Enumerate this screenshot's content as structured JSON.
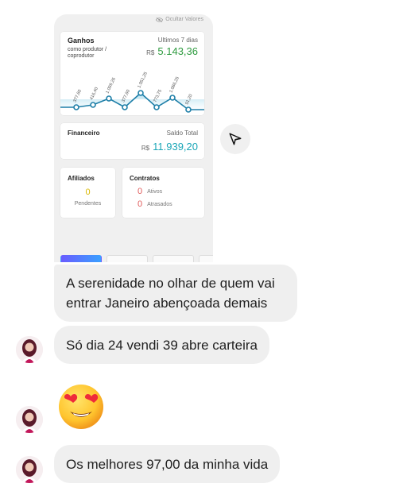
{
  "dashboard": {
    "hide_values_label": "Ocultar Valores",
    "gains": {
      "title": "Ganhos",
      "subtitle": "como produtor / coprodutor",
      "period": "Ultimos 7 dias",
      "currency": "R$",
      "value": "5.143,36",
      "accent": "#2e9b3f"
    },
    "chart_labels": [
      "377,60",
      "416,40",
      "1.099,26",
      "377,60",
      "1.051,25",
      "773,75",
      "1.086,25",
      "91,20"
    ],
    "financial": {
      "title": "Financeiro",
      "label": "Saldo Total",
      "currency": "R$",
      "value": "11.939,20",
      "accent": "#1aa6b7"
    },
    "affiliates": {
      "title": "Afiliados",
      "count": "0",
      "label": "Pendentes"
    },
    "contracts": {
      "title": "Contratos",
      "rows": [
        {
          "count": "0",
          "label": "Ativos"
        },
        {
          "count": "0",
          "label": "Atrasados"
        }
      ]
    }
  },
  "share_icon": "paper-plane-icon",
  "messages": [
    {
      "text": "A serenidade no olhar de quem vai entrar Janeiro abençoada demais"
    },
    {
      "text": "Só dia 24 vendi 39 abre carteira"
    },
    {
      "emoji": "😍"
    },
    {
      "text": "Os melhores 97,00 da minha vida"
    }
  ]
}
